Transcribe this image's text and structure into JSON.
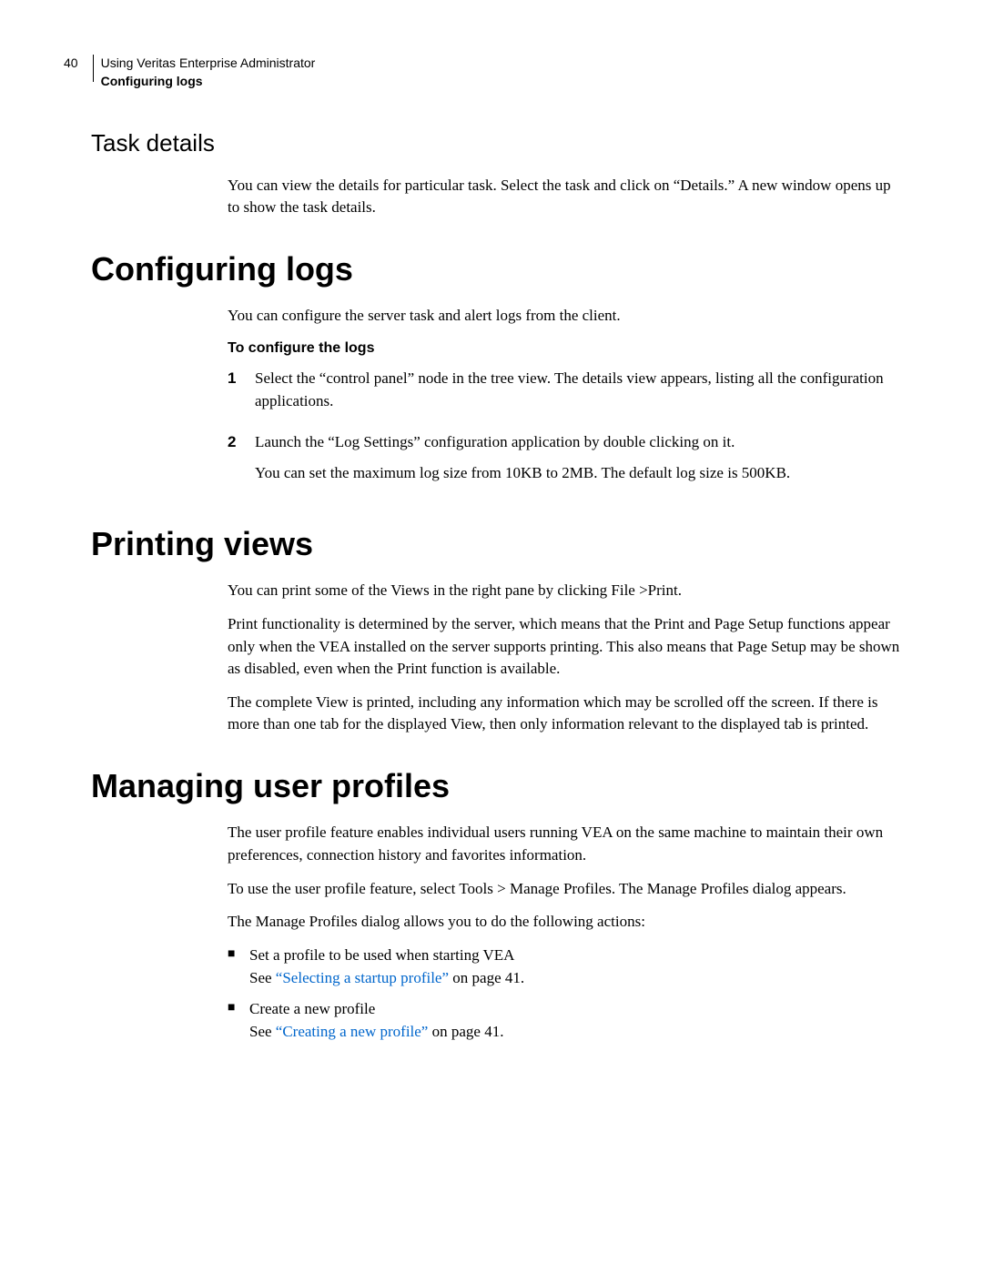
{
  "header": {
    "page_number": "40",
    "chapter": "Using Veritas Enterprise Administrator",
    "section": "Configuring logs"
  },
  "task_details": {
    "heading": "Task details",
    "para1": "You can view the details for particular task. Select the task and click on “Details.” A new window opens up to show the task details."
  },
  "configuring_logs": {
    "heading": "Configuring logs",
    "para1": "You can configure the server task and alert logs from the client.",
    "sub_bold": "To configure the logs",
    "steps": [
      {
        "num": "1",
        "text": "Select the “control panel” node in the tree view. The details view appears, listing all the configuration applications."
      },
      {
        "num": "2",
        "text": "Launch the “Log Settings” configuration application by double clicking on it.",
        "after": "You can set the maximum log size from 10KB to 2MB. The default log size is 500KB."
      }
    ]
  },
  "printing_views": {
    "heading": "Printing views",
    "para1": "You can print some of the Views in the right pane by clicking File >Print.",
    "para2": "Print functionality is determined by the server, which means that the Print and Page Setup functions appear only when the VEA installed on the server supports printing. This also means that Page Setup may be shown as disabled, even when the Print function is available.",
    "para3": "The complete View is printed, including any information which may be scrolled off the screen. If there is more than one tab for the displayed View, then only information relevant to the displayed tab is printed."
  },
  "managing_profiles": {
    "heading": "Managing user profiles",
    "para1": "The user profile feature enables individual users running VEA on the same machine to maintain their own preferences, connection history and favorites information.",
    "para2": "To use the user profile feature, select Tools > Manage Profiles. The Manage Profiles dialog appears.",
    "para3": "The Manage Profiles dialog allows you to do the following actions:",
    "bullets": [
      {
        "line1": "Set a profile to be used when starting VEA",
        "see_prefix": "See ",
        "link": "“Selecting a startup profile”",
        "see_suffix": " on page 41."
      },
      {
        "line1": "Create a new profile",
        "see_prefix": "See ",
        "link": "“Creating a new profile”",
        "see_suffix": " on page 41."
      }
    ]
  }
}
